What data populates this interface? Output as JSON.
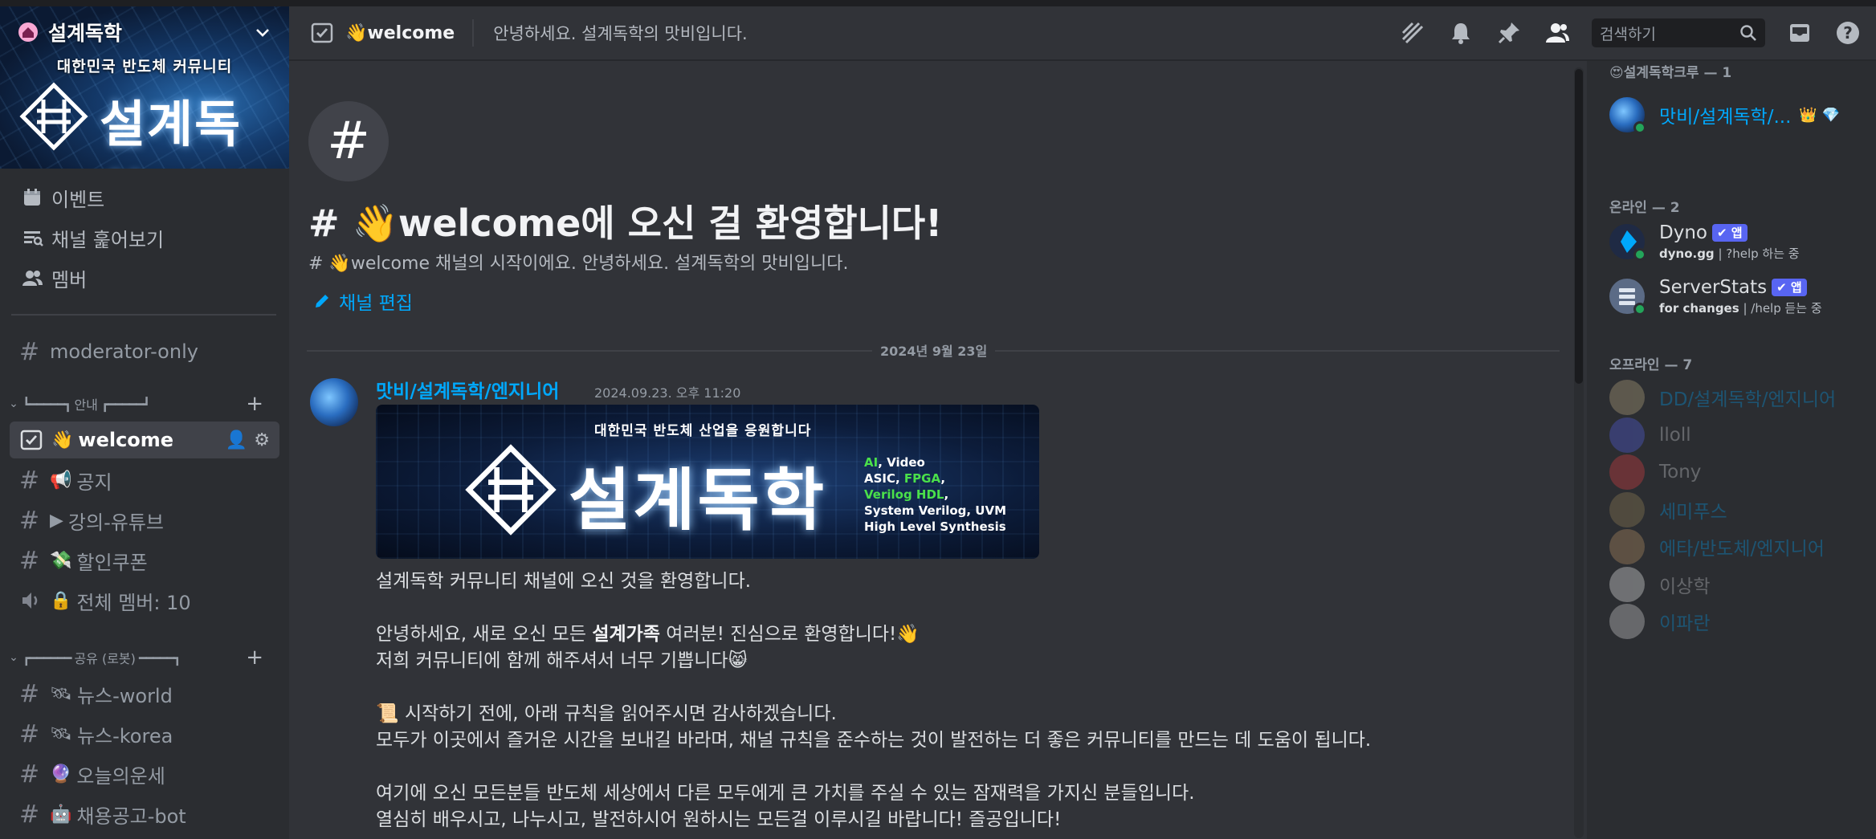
{
  "server": {
    "name": "설계독학",
    "banner_tagline": "대한민국 반도체 커뮤니티",
    "banner_title": "설계독학"
  },
  "sidebar": {
    "top_items": [
      {
        "label": "이벤트",
        "icon": "calendar-icon"
      },
      {
        "label": "채널 훑어보기",
        "icon": "browse-channels-icon"
      },
      {
        "label": "멤버",
        "icon": "members-icon"
      }
    ],
    "channels_top": [
      {
        "emoji": "",
        "label": "moderator-only"
      }
    ],
    "category_1": "안내",
    "category_1_channels": [
      {
        "emoji": "👋",
        "label": "welcome",
        "active": true
      },
      {
        "emoji": "📢",
        "label": "공지"
      },
      {
        "emoji": "▶",
        "label": "강의-유튜브"
      },
      {
        "emoji": "💸",
        "label": "할인쿠폰"
      },
      {
        "emoji": "🔒",
        "label": "전체 멤버: 10",
        "voice": true
      }
    ],
    "category_2": "공유 (로봇)",
    "category_2_channels": [
      {
        "emoji": "🛰",
        "label": "뉴스-world"
      },
      {
        "emoji": "🛰",
        "label": "뉴스-korea"
      },
      {
        "emoji": "🔮",
        "label": "오늘의운세"
      },
      {
        "emoji": "🤖",
        "label": "채용공고-bot"
      }
    ]
  },
  "header": {
    "channel_emoji": "👋",
    "channel_name": "welcome",
    "topic": "안녕하세요. 설계독학의 맛비입니다.",
    "search_placeholder": "검색하기",
    "icons": [
      "threads-icon",
      "bell-icon",
      "pin-icon",
      "members-list-icon",
      "inbox-icon",
      "help-icon"
    ]
  },
  "chat": {
    "intro_title": "# 👋welcome에 오신 걸 환영합니다!",
    "intro_sub": "# 👋welcome 채널의 시작이에요. 안녕하세요. 설계독학의 맛비입니다.",
    "edit_channel": "채널 편집",
    "date_divider": "2024년 9월 23일",
    "message": {
      "author": "맛비/설계독학/엔지니어",
      "timestamp": "2024.09.23. 오후 11:20",
      "image": {
        "tagline": "대한민국 반도체 산업을 응원합니다",
        "title": "설계독학",
        "lines": [
          [
            {
              "t": "AI",
              "g": true
            },
            {
              "t": ", Video",
              "g": false
            }
          ],
          [
            {
              "t": "ASIC, ",
              "g": false
            },
            {
              "t": "FPGA",
              "g": true
            },
            {
              "t": ",",
              "g": false
            }
          ],
          [
            {
              "t": "Verilog HDL",
              "g": true
            },
            {
              "t": ",",
              "g": false
            }
          ],
          [
            {
              "t": "System Verilog, UVM",
              "g": false
            }
          ],
          [
            {
              "t": "High Level Synthesis",
              "g": false
            }
          ]
        ]
      },
      "lines": [
        "설계독학 커뮤니티 채널에 오신 것을 환영합니다.",
        "",
        "안녕하세요, 새로 오신 모든 |설계가족| 여러분! 진심으로 환영합니다!👋",
        "저희 커뮤니티에 함께 해주셔서 너무 기쁩니다😸",
        "",
        "📜 시작하기 전에, 아래 규칙을 읽어주시면 감사하겠습니다.",
        "모두가 이곳에서 즐거운 시간을 보내길 바라며, 채널 규칙을 준수하는 것이 발전하는 더 좋은 커뮤니티를 만드는 데 도움이 됩니다.",
        "",
        "여기에 오신 모든분들 반도체 세상에서 다른 모두에게 큰 가치를 주실 수 있는 잠재력을 가지신 분들입니다.",
        "열심히 배우시고, 나누시고, 발전하시어 원하시는 모든걸 이루시길 바랍니다! 즐공입니다!"
      ]
    }
  },
  "members": {
    "group_crew": "😍설계독학크루 — 1",
    "crew": [
      {
        "name": "맛비/설계독학/...",
        "color": "#00a8fc",
        "badges": "👑 💎"
      }
    ],
    "group_online": "온라인 — 2",
    "online": [
      {
        "name": "Dyno",
        "app": "✔ 앱",
        "status_bold": "dyno.gg",
        "status": " | ?help 하는 중"
      },
      {
        "name": "ServerStats",
        "app": "✔ 앱",
        "status_bold": "for changes",
        "status": " | /help 듣는 중"
      }
    ],
    "group_offline": "오프라인 — 7",
    "offline": [
      {
        "name": "DD/설계독학/엔지니어",
        "color": "#00a8fc",
        "av": "#c8b58a"
      },
      {
        "name": "lloll",
        "color": "#dbdee1",
        "av": "#5865f2"
      },
      {
        "name": "Tony",
        "color": "#dbdee1",
        "av": "#ed4245"
      },
      {
        "name": "세미푸스",
        "color": "#00a8fc",
        "av": "#a08a5a"
      },
      {
        "name": "에타/반도체/엔지니어",
        "color": "#00a8fc",
        "av": "#c79d6a"
      },
      {
        "name": "이상학",
        "color": "#dbdee1",
        "av": "#ffffff"
      },
      {
        "name": "이파란",
        "color": "#00a8fc",
        "av": "#e6e6e6"
      }
    ]
  }
}
